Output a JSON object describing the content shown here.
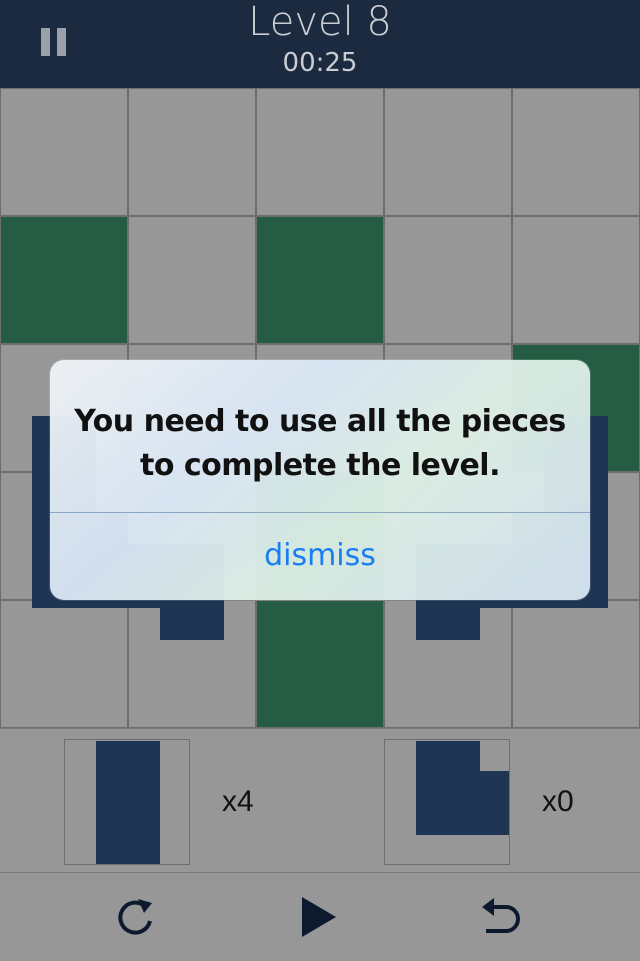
{
  "header": {
    "title": "Level 8",
    "timer": "00:25",
    "pause_icon": "pause-icon"
  },
  "board": {
    "rows": 5,
    "cols": 5,
    "filled_cells": [
      [
        1,
        0
      ],
      [
        1,
        2
      ],
      [
        2,
        4
      ],
      [
        3,
        2
      ],
      [
        4,
        2
      ]
    ]
  },
  "tray": {
    "pieces": [
      {
        "name": "straight-piece",
        "count": "x4"
      },
      {
        "name": "l-corner-piece",
        "count": "x0"
      }
    ]
  },
  "toolbar": {
    "icons": [
      "rotate-icon",
      "play-icon",
      "undo-icon"
    ]
  },
  "alert": {
    "line1": "You need to use all the pieces",
    "line2": "to complete the level.",
    "button": "dismiss"
  },
  "colors": {
    "header": "#1c2a40",
    "board_cell": "#979797",
    "target_cell": "#255c44",
    "piece": "#1f3554",
    "alert_button": "#1a7ef0"
  }
}
